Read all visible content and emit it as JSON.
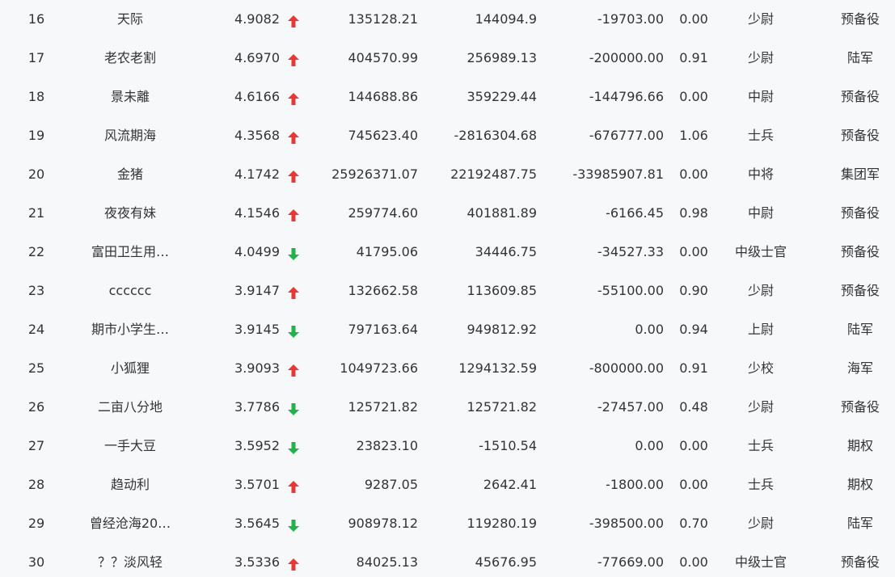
{
  "colors": {
    "up": "#e53935",
    "down": "#22b14c",
    "background": "#f7f8fa",
    "text": "#333333"
  },
  "rows": [
    {
      "rank": "16",
      "name": "天际",
      "score": "4.9082",
      "trend": "up",
      "v1": "135128.21",
      "v2": "144094.9",
      "v3": "-19703.00",
      "ratio": "0.00",
      "title": "少尉",
      "corps": "预备役"
    },
    {
      "rank": "17",
      "name": "老农老割",
      "score": "4.6970",
      "trend": "up",
      "v1": "404570.99",
      "v2": "256989.13",
      "v3": "-200000.00",
      "ratio": "0.91",
      "title": "少尉",
      "corps": "陆军"
    },
    {
      "rank": "18",
      "name": "景未離",
      "score": "4.6166",
      "trend": "up",
      "v1": "144688.86",
      "v2": "359229.44",
      "v3": "-144796.66",
      "ratio": "0.00",
      "title": "中尉",
      "corps": "预备役"
    },
    {
      "rank": "19",
      "name": "风流期海",
      "score": "4.3568",
      "trend": "up",
      "v1": "745623.40",
      "v2": "-2816304.68",
      "v3": "-676777.00",
      "ratio": "1.06",
      "title": "士兵",
      "corps": "预备役"
    },
    {
      "rank": "20",
      "name": "金猪",
      "score": "4.1742",
      "trend": "up",
      "v1": "25926371.07",
      "v2": "22192487.75",
      "v3": "-33985907.81",
      "ratio": "0.00",
      "title": "中将",
      "corps": "集团军"
    },
    {
      "rank": "21",
      "name": "夜夜有妹",
      "score": "4.1546",
      "trend": "up",
      "v1": "259774.60",
      "v2": "401881.89",
      "v3": "-6166.45",
      "ratio": "0.98",
      "title": "中尉",
      "corps": "预备役"
    },
    {
      "rank": "22",
      "name": "富田卫生用…",
      "score": "4.0499",
      "trend": "down",
      "v1": "41795.06",
      "v2": "34446.75",
      "v3": "-34527.33",
      "ratio": "0.00",
      "title": "中级士官",
      "corps": "预备役"
    },
    {
      "rank": "23",
      "name": "cccccc",
      "score": "3.9147",
      "trend": "up",
      "v1": "132662.58",
      "v2": "113609.85",
      "v3": "-55100.00",
      "ratio": "0.90",
      "title": "少尉",
      "corps": "预备役"
    },
    {
      "rank": "24",
      "name": "期市小学生…",
      "score": "3.9145",
      "trend": "down",
      "v1": "797163.64",
      "v2": "949812.92",
      "v3": "0.00",
      "ratio": "0.94",
      "title": "上尉",
      "corps": "陆军"
    },
    {
      "rank": "25",
      "name": "小狐狸",
      "score": "3.9093",
      "trend": "up",
      "v1": "1049723.66",
      "v2": "1294132.59",
      "v3": "-800000.00",
      "ratio": "0.91",
      "title": "少校",
      "corps": "海军"
    },
    {
      "rank": "26",
      "name": "二亩八分地",
      "score": "3.7786",
      "trend": "down",
      "v1": "125721.82",
      "v2": "125721.82",
      "v3": "-27457.00",
      "ratio": "0.48",
      "title": "少尉",
      "corps": "预备役"
    },
    {
      "rank": "27",
      "name": "一手大豆",
      "score": "3.5952",
      "trend": "down",
      "v1": "23823.10",
      "v2": "-1510.54",
      "v3": "0.00",
      "ratio": "0.00",
      "title": "士兵",
      "corps": "期权"
    },
    {
      "rank": "28",
      "name": "趋动利",
      "score": "3.5701",
      "trend": "up",
      "v1": "9287.05",
      "v2": "2642.41",
      "v3": "-1800.00",
      "ratio": "0.00",
      "title": "士兵",
      "corps": "期权"
    },
    {
      "rank": "29",
      "name": "曾经沧海20…",
      "score": "3.5645",
      "trend": "down",
      "v1": "908978.12",
      "v2": "119280.19",
      "v3": "-398500.00",
      "ratio": "0.70",
      "title": "少尉",
      "corps": "陆军"
    },
    {
      "rank": "30",
      "name": "？？淡风轻",
      "score": "3.5336",
      "trend": "up",
      "v1": "84025.13",
      "v2": "45676.95",
      "v3": "-77669.00",
      "ratio": "0.00",
      "title": "中级士官",
      "corps": "预备役"
    }
  ]
}
